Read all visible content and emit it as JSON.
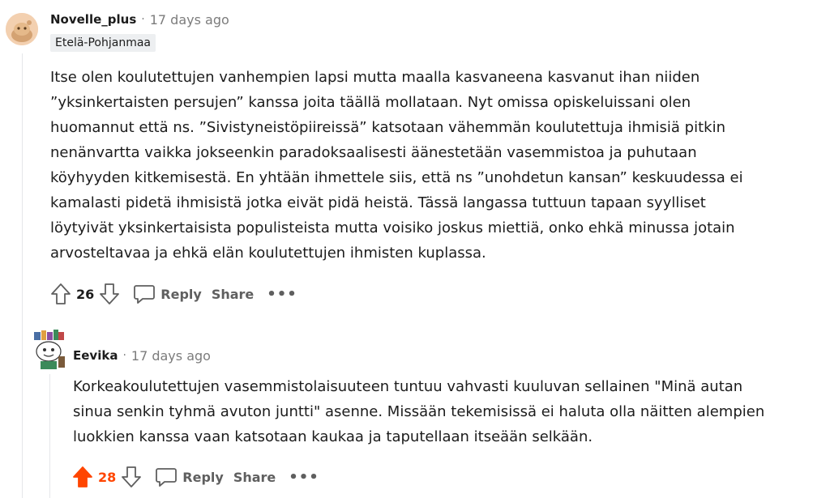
{
  "comments": [
    {
      "username": "Novelle_plus",
      "separator": "·",
      "time": "17 days ago",
      "flair": "Etelä-Pohjanmaa",
      "body_lines": [
        "Itse olen koulutettujen vanhempien lapsi mutta maalla kasvaneena kasvanut ihan niiden",
        "”yksinkertaisten persujen” kanssa joita täällä mollataan. Nyt omissa opiskeluissani olen",
        "huomannut että ns. ”Sivistyneistöpiireissä” katsotaan vähemmän koulutettuja ihmisiä pitkin",
        "nenänvartta vaikka jokseenkin paradoksaalisesti äänestetään vasemmistoa ja puhutaan",
        "köyhyyden kitkemisestä. En yhtään ihmettele siis, että ns ”unohdetun kansan” keskuudessa ei",
        "kamalasti pidetä ihmisistä jotka eivät pidä heistä. Tässä langassa tuttuun tapaan syylliset",
        "löytyivät yksinkertaisista populisteista mutta voisiko joskus miettiä, onko ehkä minussa jotain",
        "arvosteltavaa ja ehkä elän koulutettujen ihmisten kuplassa."
      ],
      "score": "26",
      "upvoted": false,
      "reply_label": "Reply",
      "share_label": "Share",
      "more_label": "•••"
    },
    {
      "username": "Eevika",
      "separator": "·",
      "time": "17 days ago",
      "body_lines": [
        "Korkeakoulutettujen vasemmistolaisuuteen tuntuu vahvasti kuuluvan sellainen \"Minä autan",
        "sinua senkin tyhmä avuton juntti\" asenne. Missään tekemisissä ei haluta olla näitten alempien",
        "luokkien kanssa vaan katsotaan kaukaa ja taputellaan itseään selkään."
      ],
      "score": "28",
      "upvoted": true,
      "reply_label": "Reply",
      "share_label": "Share",
      "more_label": "•••"
    }
  ],
  "colors": {
    "upvote_active": "#ff4500",
    "meta_text": "#7c7c7c",
    "thread_line": "#e5e7e9",
    "flair_bg": "#edeff1"
  },
  "icons": {
    "upvote": "arrow-up-icon",
    "downvote": "arrow-down-icon",
    "reply": "speech-bubble-icon"
  }
}
